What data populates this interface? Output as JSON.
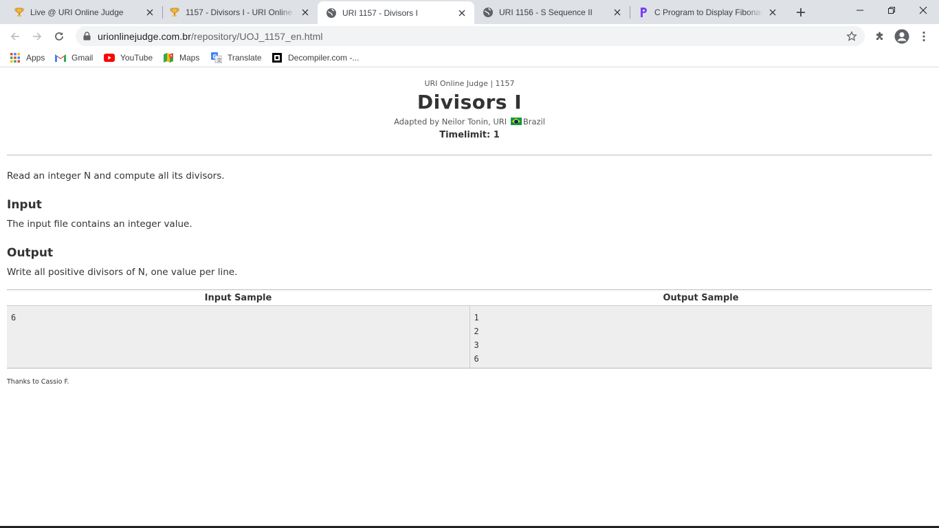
{
  "tabs": [
    {
      "title": "Live @ URI Online Judge",
      "icon": "trophy-icon",
      "active": false
    },
    {
      "title": "1157 - Divisors I - URI Online Judge",
      "icon": "trophy-icon",
      "active": false
    },
    {
      "title": "URI 1157 - Divisors I",
      "icon": "globe-icon",
      "active": true
    },
    {
      "title": "URI 1156 - S Sequence II",
      "icon": "globe-icon",
      "active": false
    },
    {
      "title": "C Program to Display Fibonacci",
      "icon": "p-logo-icon",
      "active": false
    }
  ],
  "address": {
    "host": "urionlinejudge.com.br",
    "path": "/repository/UOJ_1157_en.html"
  },
  "bookmarks": [
    {
      "label": "Apps",
      "icon": "apps-grid-icon"
    },
    {
      "label": "Gmail",
      "icon": "gmail-icon"
    },
    {
      "label": "YouTube",
      "icon": "youtube-icon"
    },
    {
      "label": "Maps",
      "icon": "maps-icon"
    },
    {
      "label": "Translate",
      "icon": "translate-icon"
    },
    {
      "label": "Decompiler.com -...",
      "icon": "decompiler-icon"
    }
  ],
  "problem": {
    "source": "URI Online Judge | 1157",
    "title": "Divisors I",
    "author_prefix": "Adapted by Neilor Tonin, URI",
    "country": "Brazil",
    "timelimit": "Timelimit: 1",
    "description": "Read an integer N and compute all its divisors.",
    "input_heading": "Input",
    "input_text": "The input file contains an integer value.",
    "output_heading": "Output",
    "output_text": "Write all positive divisors of N, one value per line.",
    "samples": {
      "input_header": "Input Sample",
      "output_header": "Output Sample",
      "input_lines": [
        "6"
      ],
      "output_lines": [
        "1",
        "2",
        "3",
        "6"
      ]
    },
    "thanks": "Thanks to Cassio F."
  },
  "colors": {
    "tabstrip": "#dee1e6",
    "omnibox": "#f1f3f4",
    "sample_bg": "#eeeeee",
    "text": "#333333"
  }
}
